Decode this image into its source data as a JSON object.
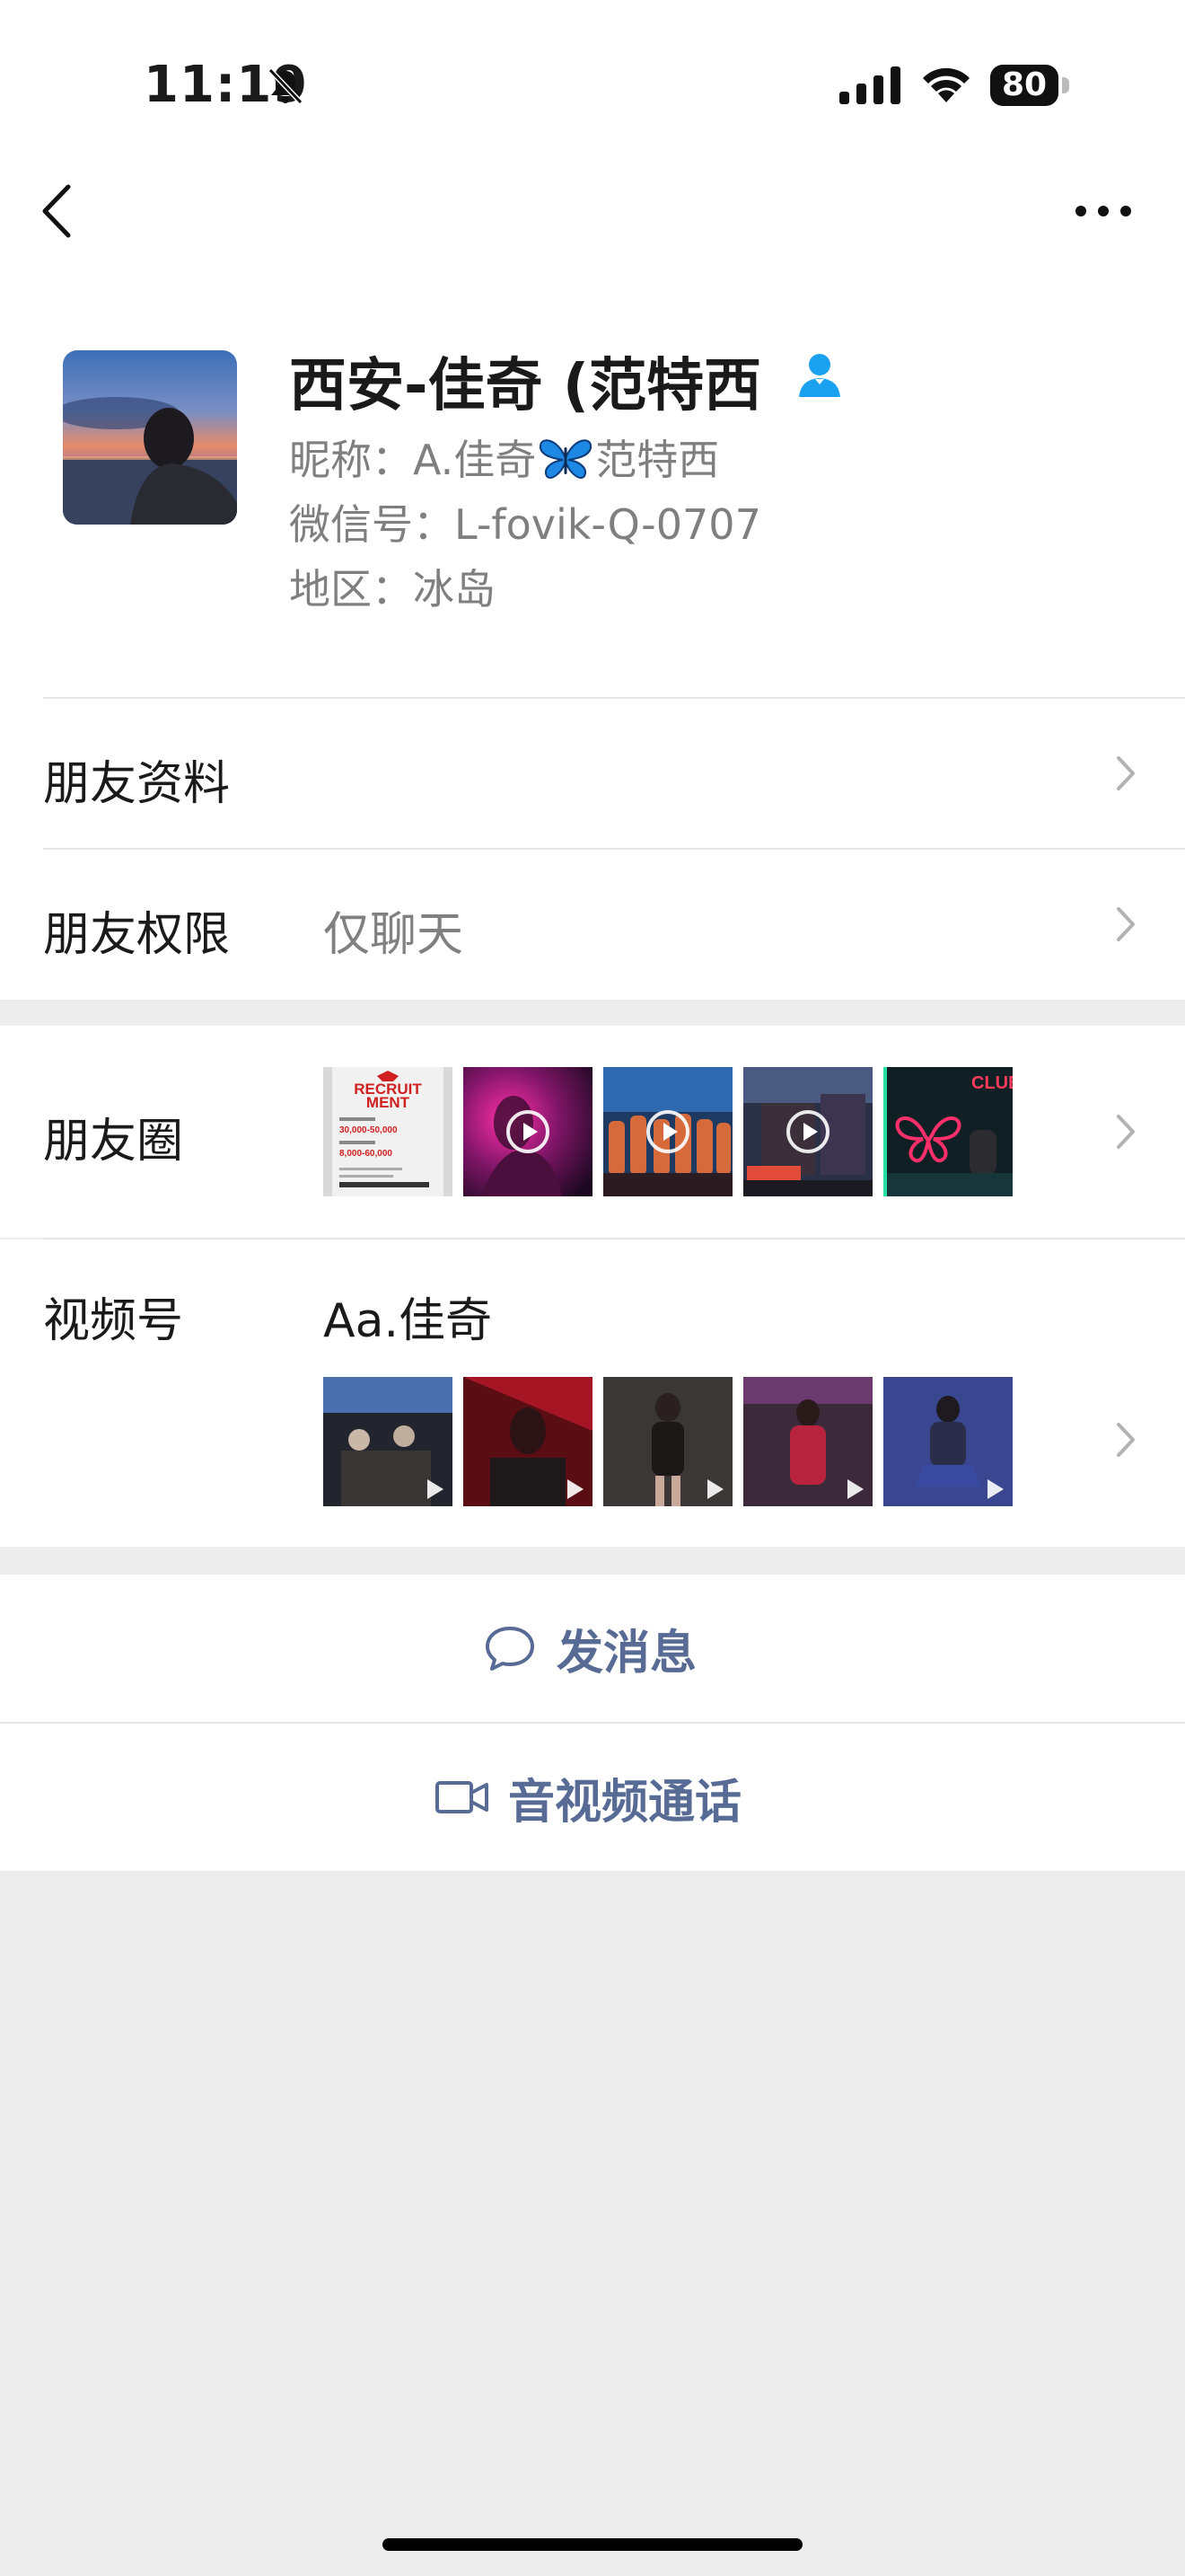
{
  "status_bar": {
    "time": "11:19",
    "battery": "80"
  },
  "profile": {
    "name": "西安-佳奇 (范特西",
    "nickname_label": "昵称：",
    "nickname_pre": "A.佳奇",
    "nickname_post": "范特西",
    "wechat_id_label": "微信号：",
    "wechat_id": "L-fovik-Q-0707",
    "region_label": "地区：",
    "region": "冰岛"
  },
  "rows": {
    "friend_profile": "朋友资料",
    "friend_permissions": "朋友权限",
    "permissions_value": "仅聊天",
    "moments": "朋友圈",
    "channels": "视频号",
    "channels_name": "Aa.佳奇"
  },
  "moments_thumb_text": {
    "title_line1": "RECRUIT",
    "title_line2": "MENT",
    "salary1": "30,000-50,000",
    "salary2": "8,000-60,000",
    "club": "CLUB"
  },
  "actions": {
    "send_message": "发消息",
    "av_call": "音视频通话"
  },
  "colors": {
    "link_blue": "#576b95",
    "background_gray": "#ededed",
    "friend_icon": "#1aa1f0"
  }
}
